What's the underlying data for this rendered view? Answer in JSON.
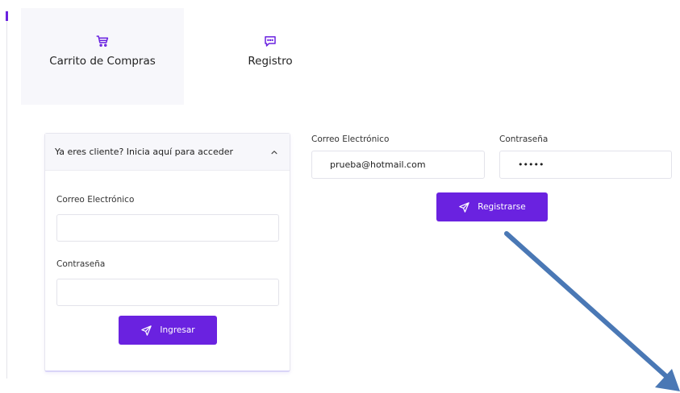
{
  "tabs": [
    {
      "label": "Carrito de Compras",
      "icon": "shopping-cart-icon"
    },
    {
      "label": "Registro",
      "icon": "chat-bubble-icon"
    }
  ],
  "login": {
    "header": "Ya eres cliente? Inicia aquí para acceder",
    "email_label": "Correo Electrónico",
    "email_value": "",
    "password_label": "Contraseña",
    "password_value": "",
    "submit_label": "Ingresar"
  },
  "register": {
    "email_label": "Correo Electrónico",
    "email_value": "prueba@hotmail.com",
    "password_label": "Contraseña",
    "password_value": "•••••",
    "submit_label": "Registrarse"
  },
  "colors": {
    "accent": "#6a22e0",
    "annotation_arrow": "#4a78b5"
  }
}
